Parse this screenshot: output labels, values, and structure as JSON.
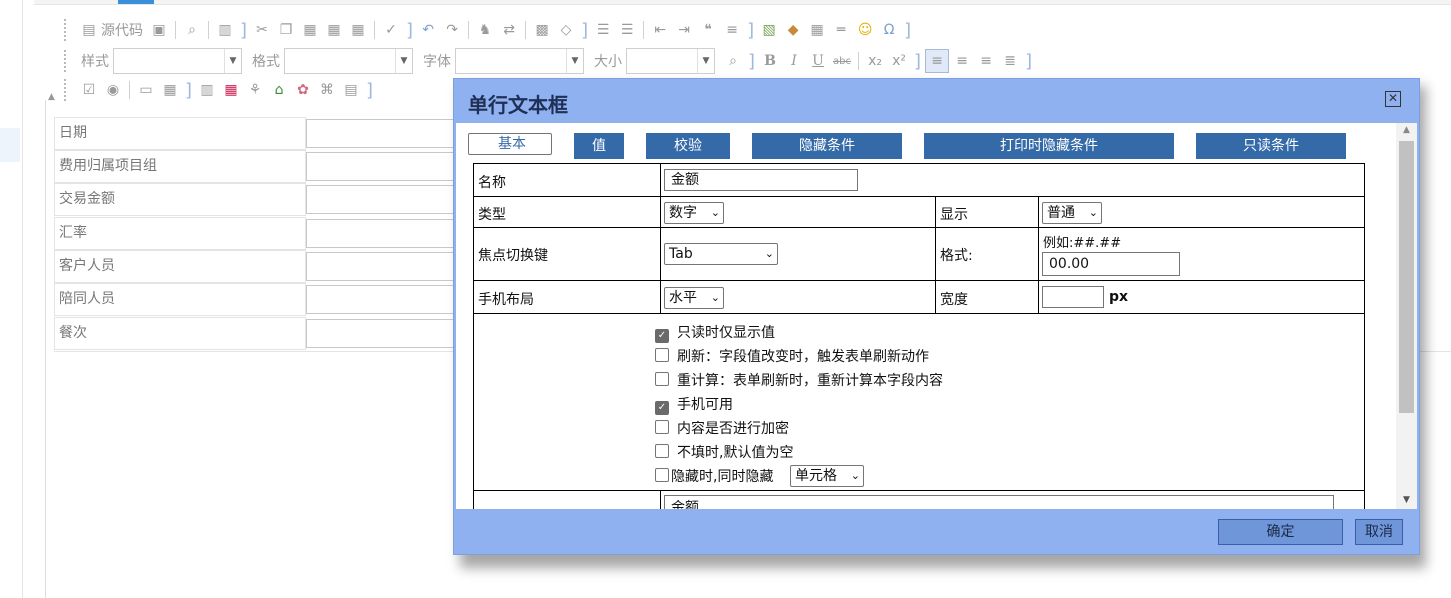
{
  "toolbar": {
    "source_label": "源代码",
    "style_label": "样式",
    "format_label": "格式",
    "font_label": "字体",
    "size_label": "大小",
    "bold": "B",
    "italic": "I",
    "underline": "U",
    "strike": "abc",
    "omega": "Ω"
  },
  "form": {
    "rows": [
      {
        "label": "日期"
      },
      {
        "label": "费用归属项目组"
      },
      {
        "label": "交易金额"
      },
      {
        "label": "汇率"
      },
      {
        "label": "客户人员"
      },
      {
        "label": "陪同人员"
      },
      {
        "label": "餐次"
      }
    ]
  },
  "dialog": {
    "title": "单行文本框",
    "close_icon": "close-icon",
    "tabs": [
      {
        "label": "基本",
        "selected": true
      },
      {
        "label": "值"
      },
      {
        "label": "校验"
      },
      {
        "label": "隐藏条件"
      },
      {
        "label": "打印时隐藏条件"
      },
      {
        "label": "只读条件"
      }
    ],
    "props": {
      "name_label": "名称",
      "name_value": "金额",
      "type_label": "类型",
      "type_value": "数字",
      "display_label": "显示",
      "display_value": "普通",
      "focus_label": "焦点切换键",
      "focus_value": "Tab",
      "format_label": "格式:",
      "format_hint": "例如:##.##",
      "format_value": "00.00",
      "mobile_layout_label": "手机布局",
      "mobile_layout_value": "水平",
      "width_label": "宽度",
      "width_unit": "px",
      "partial_value": "金额"
    },
    "checkboxes": [
      {
        "label": "只读时仅显示值",
        "checked": true
      },
      {
        "label": "刷新：字段值改变时，触发表单刷新动作",
        "checked": false
      },
      {
        "label": "重计算：表单刷新时，重新计算本字段内容",
        "checked": false
      },
      {
        "label": "手机可用",
        "checked": true
      },
      {
        "label": "内容是否进行加密",
        "checked": false
      },
      {
        "label": "不填时,默认值为空",
        "checked": false
      },
      {
        "label": "隐藏时,同时隐藏",
        "checked": false
      }
    ],
    "hide_scope_value": "单元格",
    "ok_label": "确定",
    "cancel_label": "取消"
  }
}
